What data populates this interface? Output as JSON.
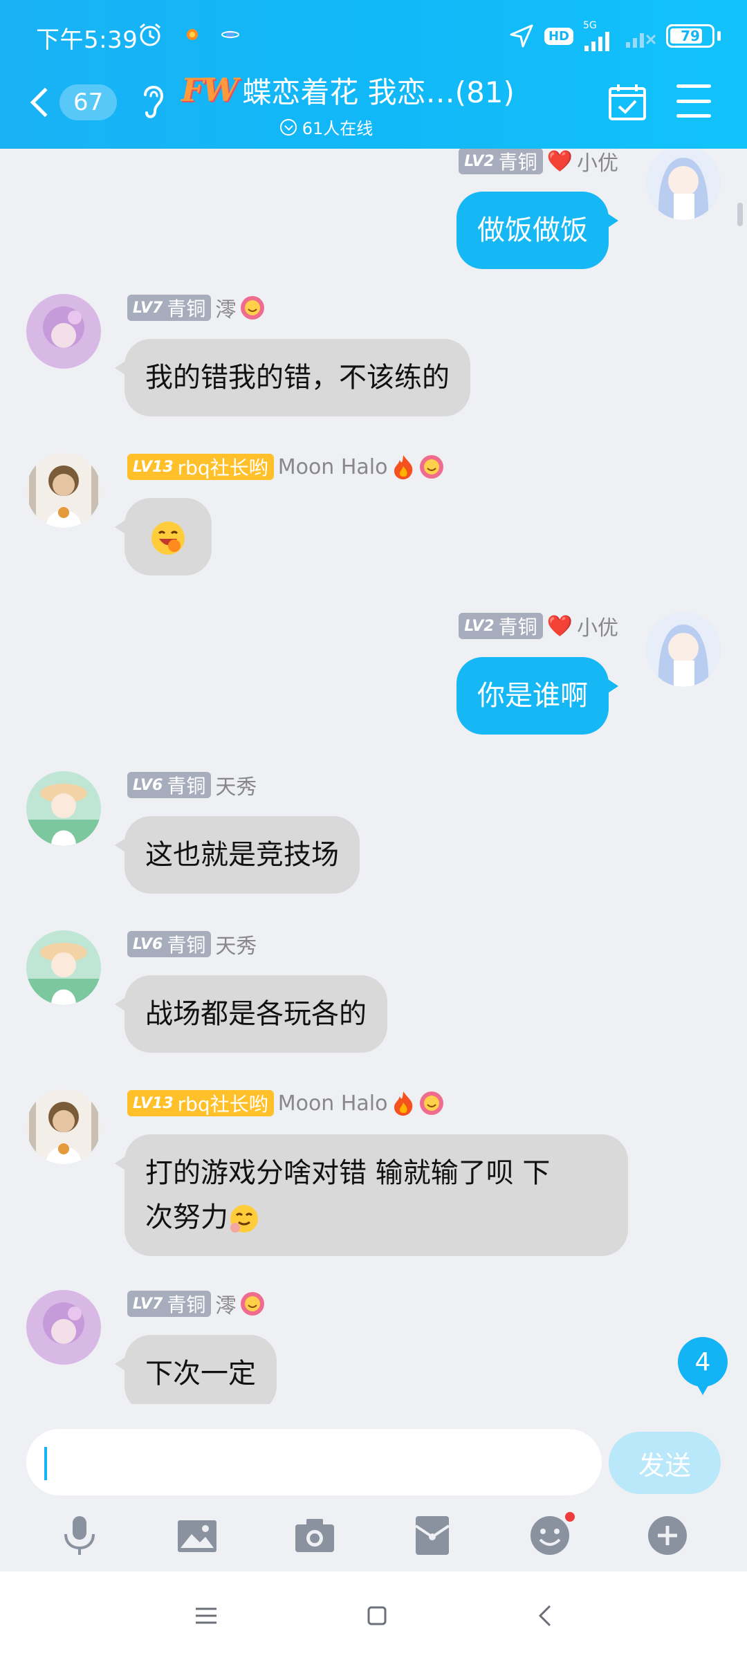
{
  "status_bar": {
    "time": "下午5:39",
    "network_hd": "HD",
    "network_type": "5G",
    "battery": "79",
    "battery_level_percent": 79
  },
  "header": {
    "back_count": "67",
    "title": "蝶恋着花 我恋…(81)",
    "online": "61人在线"
  },
  "messages": [
    {
      "side": "right",
      "level": "LV2",
      "rank": "青铜",
      "name": "小优",
      "heart": "❤️",
      "text": "做饭做饭"
    },
    {
      "side": "left",
      "level": "LV7",
      "rank": "青铜",
      "name": "澪",
      "text": "我的错我的错，不该练的"
    },
    {
      "side": "left",
      "level": "LV13",
      "rank": "rbq社长哟",
      "name": "Moon Halo",
      "text": ""
    },
    {
      "side": "right",
      "level": "LV2",
      "rank": "青铜",
      "name": "小优",
      "heart": "❤️",
      "text": "你是谁啊"
    },
    {
      "side": "left",
      "level": "LV6",
      "rank": "青铜",
      "name": "天秀",
      "text": "这也就是竞技场"
    },
    {
      "side": "left",
      "level": "LV6",
      "rank": "青铜",
      "name": "天秀",
      "text": "战场都是各玩各的"
    },
    {
      "side": "left",
      "level": "LV13",
      "rank": "rbq社长哟",
      "name": "Moon Halo",
      "text_line1": "打的游戏分啥对错 输就输了呗 下",
      "text_line2": "次努力"
    },
    {
      "side": "left",
      "level": "LV7",
      "rank": "青铜",
      "name": "澪",
      "text": "下次一定"
    }
  ],
  "unread_count": "4",
  "input": {
    "placeholder": "",
    "value": ""
  },
  "send_label": "发送",
  "colors": {
    "accent": "#15b8f5",
    "bubble_left": "#d9d9d9",
    "gold_badge": "#ffc02a",
    "gray_badge": "#a7adbd"
  }
}
